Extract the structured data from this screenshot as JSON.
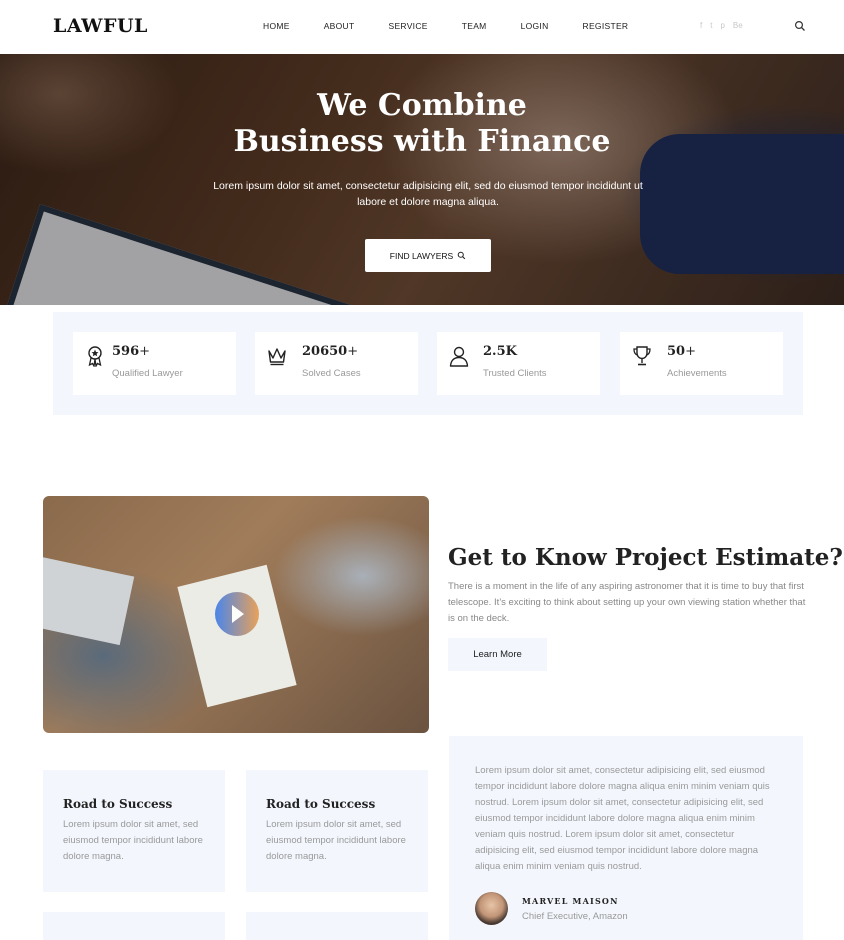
{
  "header": {
    "logo": "LAWFUL",
    "nav": [
      "HOME",
      "ABOUT",
      "SERVICE",
      "TEAM",
      "LOGIN",
      "REGISTER"
    ],
    "social": [
      "f",
      "t",
      "p",
      "Be"
    ]
  },
  "hero": {
    "title_line1": "We Combine",
    "title_line2": "Business with Finance",
    "subtitle": "Lorem ipsum dolor sit amet, consectetur adipisicing elit, sed do eiusmod tempor incididunt ut labore et dolore magna aliqua.",
    "button": "FIND LAWYERS"
  },
  "stats": [
    {
      "icon": "award-icon",
      "number": "596",
      "suffix": "+",
      "label": "Qualified Lawyer"
    },
    {
      "icon": "crown-icon",
      "number": "20650",
      "suffix": "+",
      "label": "Solved Cases"
    },
    {
      "icon": "user-icon",
      "number": "2.5K",
      "suffix": "",
      "label": "Trusted Clients"
    },
    {
      "icon": "trophy-icon",
      "number": "50",
      "suffix": "+",
      "label": "Achievements"
    }
  ],
  "about": {
    "title": "Get to Know Project Estimate?",
    "text": "There is a moment in the life of any aspiring astronomer that it is time to buy that first telescope. It’s exciting to think about setting up your own viewing station whether that is on the deck.",
    "button": "Learn More"
  },
  "cards": [
    {
      "title": "Road to Success",
      "text": "Lorem ipsum dolor sit amet, sed eiusmod tempor incididunt labore dolore magna."
    },
    {
      "title": "Road to Success",
      "text": "Lorem ipsum dolor sit amet, sed eiusmod tempor incididunt labore dolore magna."
    }
  ],
  "testimonial": {
    "text": "Lorem ipsum dolor sit amet, consectetur adipisicing elit, sed eiusmod tempor incididunt labore dolore magna aliqua enim minim veniam quis nostrud. Lorem ipsum dolor sit amet, consectetur adipisicing elit, sed eiusmod tempor incididunt labore dolore magna aliqua enim minim veniam quis nostrud. Lorem ipsum dolor sit amet, consectetur adipisicing elit, sed eiusmod tempor incididunt labore dolore magna aliqua enim minim veniam quis nostrud.",
    "name": "MARVEL MAISON",
    "role": "Chief Executive, Amazon"
  },
  "colors": {
    "light_panel": "#f3f7fd",
    "text_muted": "#999999",
    "accent_blue": "#3b7bea",
    "accent_orange": "#e79a4c"
  }
}
